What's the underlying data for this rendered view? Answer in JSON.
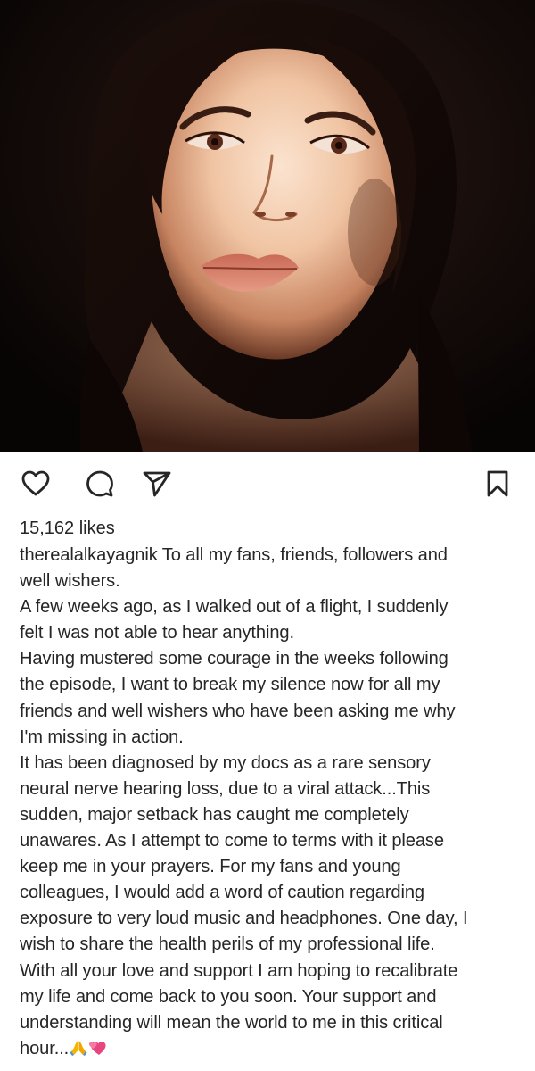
{
  "post": {
    "photo_icon": "portrait-photo",
    "likes_text": "15,162 likes",
    "username": "therealalkayagnik",
    "caption_lines": [
      " To all my fans, friends, followers and",
      "well wishers.",
      "A few weeks ago, as I walked out of a flight, I suddenly",
      "felt I was not able to hear anything.",
      "Having mustered some courage in the weeks following",
      "the episode, I want to break my silence now for all my",
      "friends and well wishers who have been asking me why",
      "I'm missing in action.",
      "It has been diagnosed by my docs as a rare sensory",
      "neural nerve hearing loss, due to a viral attack...This",
      "sudden, major setback has caught me completely",
      "unawares. As I attempt to come to terms with it please",
      "keep me in your prayers. For my fans and young",
      "colleagues, I would add a word of caution regarding",
      "exposure to very loud music and headphones. One day, I",
      "wish to share the health perils of my professional life.",
      "With all your love and support I am hoping to recalibrate",
      "my life and come back to you soon. Your support and",
      "understanding will mean the world to me in this critical",
      "hour..."
    ],
    "caption_end_emojis": [
      "folded-hands-emoji",
      "two-hearts-emoji"
    ]
  },
  "actions": {
    "like_icon": "heart-icon",
    "comment_icon": "comment-icon",
    "share_icon": "paper-plane-icon",
    "save_icon": "bookmark-icon"
  },
  "colors": {
    "text": "#262626",
    "background": "#ffffff",
    "photo_dark": "#0c0706",
    "skin_highlight": "#f6d7bf",
    "heart_pink": "#e8457f",
    "hands_yellow": "#f4b400"
  }
}
